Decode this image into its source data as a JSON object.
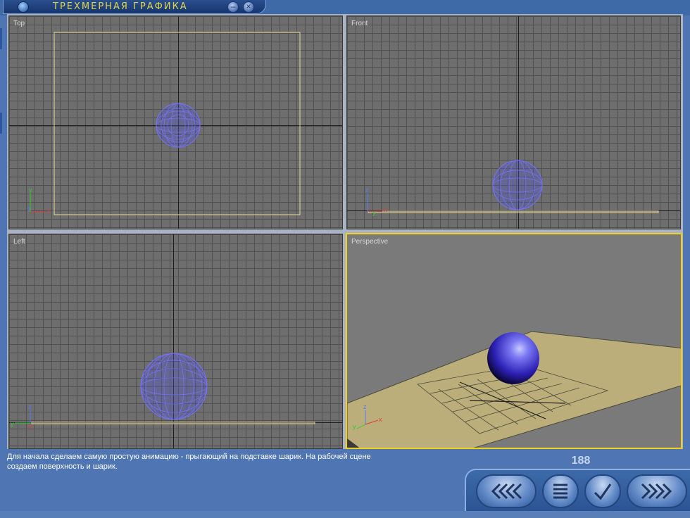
{
  "window": {
    "title": "ТРЕХМЕРНАЯ ГРАФИКА",
    "minimize_label": "–",
    "close_label": "×"
  },
  "viewports": {
    "top": {
      "label": "Top"
    },
    "front": {
      "label": "Front"
    },
    "left": {
      "label": "Left"
    },
    "perspective": {
      "label": "Perspective"
    }
  },
  "axes": {
    "top": {
      "x": "x",
      "y": "y",
      "z": "z"
    },
    "front": {
      "x": "x",
      "y": "z",
      "z": "y"
    },
    "left": {
      "x": "y",
      "y": "z",
      "z": "x"
    },
    "perspective": {
      "x": "x",
      "y": "y",
      "z": "z"
    }
  },
  "colors": {
    "sphere_wire": "#6e6ef6",
    "plane_outline": "#e7d99a",
    "active_viewport": "#f1d11b",
    "ground_plane": "#bcae7a"
  },
  "caption": {
    "line1": "Для начала сделаем самую простую анимацию - прыгающий на подставке шарик. На рабочей сцене",
    "line2": "создаем поверхность и шарик."
  },
  "page_number": "188",
  "nav": {
    "back_icon": "back-arrows-icon",
    "menu_icon": "list-icon",
    "check_icon": "check-icon",
    "forward_icon": "forward-arrows-icon"
  }
}
